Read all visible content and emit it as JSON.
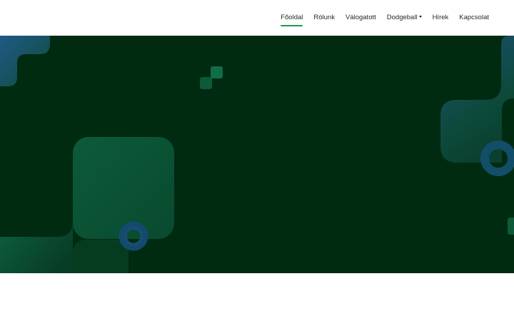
{
  "nav": {
    "items": [
      {
        "label": "Főoldal",
        "active": true
      },
      {
        "label": "Rólunk"
      },
      {
        "label": "Válogatott"
      },
      {
        "label": "Dodgeball",
        "dropdown": true
      },
      {
        "label": "Hírek"
      },
      {
        "label": "Kapcsolat"
      }
    ]
  },
  "colors": {
    "hero_background": "#002b10",
    "accent": "#1e9a4a",
    "shape_green": "#0f5a3a",
    "shape_blue": "#1d4f7a"
  }
}
